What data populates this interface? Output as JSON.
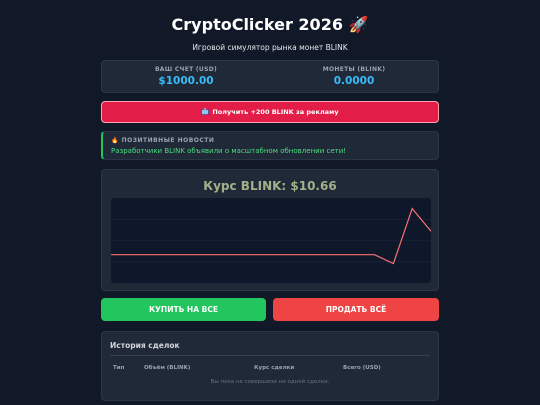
{
  "header": {
    "title": "CryptoClicker 2026 🚀",
    "subtitle": "Игровой симулятор рынка монет BLINK"
  },
  "balances": {
    "account_label": "ВАШ СЧЕТ (USD)",
    "account_value": "$1000.00",
    "coins_label": "МОНЕТЫ (BLINK)",
    "coins_value": "0.0000"
  },
  "ad_button": {
    "icon": "tv-icon",
    "label": "Получить +200 BLINK за рекламу"
  },
  "news": {
    "icon": "fire-icon",
    "heading": "ПОЗИТИВНЫЕ НОВОСТИ",
    "text": "Разработчики BLINK объявили о масштабном обновлении сети!"
  },
  "market": {
    "price_text": "Курс BLINK: $10.66"
  },
  "chart_data": {
    "type": "line",
    "title": "",
    "xlabel": "",
    "ylabel": "",
    "grid": true,
    "x": [
      0,
      1,
      2,
      3,
      4,
      5,
      6,
      7,
      8,
      9,
      10,
      11,
      12,
      13,
      14,
      15,
      16,
      17
    ],
    "values": [
      10.0,
      10.0,
      10.0,
      10.0,
      10.0,
      10.0,
      10.0,
      10.0,
      10.0,
      10.0,
      10.0,
      10.0,
      10.0,
      10.0,
      10.0,
      9.75,
      11.3,
      10.66
    ],
    "ylim": [
      9.2,
      11.6
    ],
    "line_color": "#f87171"
  },
  "actions": {
    "buy_label": "КУПИТЬ НА ВСЕ",
    "sell_label": "ПРОДАТЬ ВСЁ"
  },
  "history": {
    "title": "История сделок",
    "columns": [
      "Тип",
      "Объём (BLINK)",
      "Курс сделки",
      "Всего (USD)"
    ],
    "empty_text": "Вы пока не совершили ни одной сделки."
  },
  "colors": {
    "background": "#111827",
    "panel": "#1f2937",
    "accent_blue": "#38bdf8",
    "buy": "#22c55e",
    "sell": "#ef4444",
    "ad": "#e11d48"
  }
}
